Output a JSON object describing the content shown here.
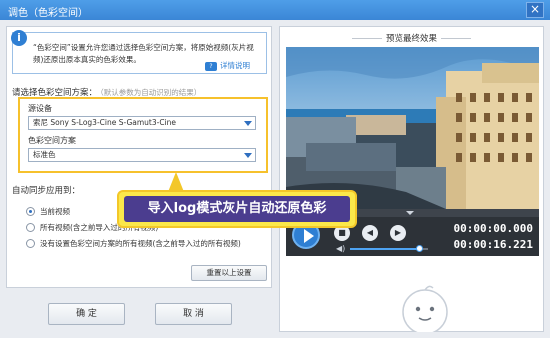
{
  "window": {
    "title": "调色（色彩空间）",
    "close_label": "×"
  },
  "info": {
    "icon": "info-icon",
    "text": "“色彩空间”设置允许您通过选择色彩空间方案，将原始视频(灰片视频)还原出原本真实的色彩效果。",
    "help_label": "详情说明",
    "help_icon": "help-icon"
  },
  "scheme": {
    "label": "请选择色彩空间方案：",
    "hint": "（默认参数为自动识别的结果）",
    "source_label": "源设备",
    "source_value": "索尼 Sony S-Log3-Cine S-Gamut3-Cine",
    "space_label": "色彩空间方案",
    "space_value": "标准色"
  },
  "sync": {
    "label": "自动同步应用到：",
    "options": [
      {
        "label": "当前视频",
        "selected": true
      },
      {
        "label": "所有视频(含之前导入过的所有视频)",
        "selected": false
      },
      {
        "label": "没有设置色彩空间方案的所有视频(含之前导入过的所有视频)",
        "selected": false
      }
    ]
  },
  "reset_label": "重置以上设置",
  "ok_label": "确 定",
  "cancel_label": "取 消",
  "preview": {
    "title": "预览最终效果",
    "time_current": "00:00:00.000",
    "time_total": "00:00:16.221",
    "volume": 0.9
  },
  "callout_text": "导入log模式灰片自动还原色彩",
  "colors": {
    "title_bar": "#3b86d6",
    "accent": "#2f7fd3",
    "highlight_border": "#f6c12c",
    "callout_bg": "#4b3d8f",
    "callout_border": "#fbe84a"
  }
}
